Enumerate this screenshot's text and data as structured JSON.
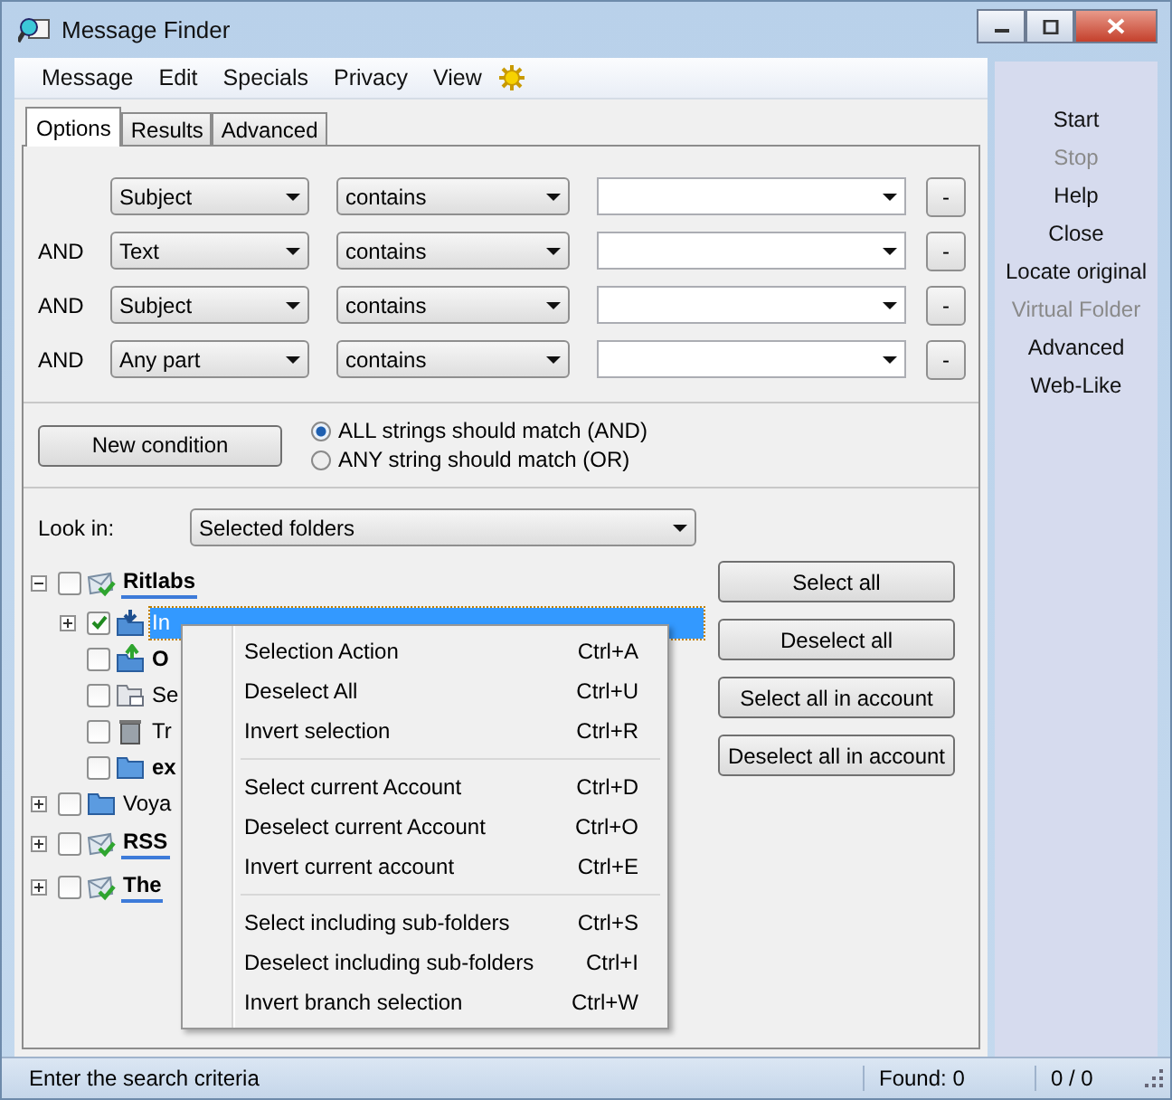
{
  "window": {
    "title": "Message Finder"
  },
  "menu": [
    "Message",
    "Edit",
    "Specials",
    "Privacy",
    "View"
  ],
  "tabs": [
    {
      "label": "Options",
      "selected": true
    },
    {
      "label": "Results",
      "selected": false
    },
    {
      "label": "Advanced",
      "selected": false
    }
  ],
  "conditions": [
    {
      "field": "Subject",
      "operator": "contains",
      "remove_button": "-"
    },
    {
      "connector": "AND",
      "field": "Text",
      "operator": "contains",
      "remove_button": "-"
    },
    {
      "connector": "AND",
      "field": "Subject",
      "operator": "contains",
      "remove_button": "-"
    },
    {
      "connector": "AND",
      "field": "Any part",
      "operator": "contains",
      "remove_button": "-"
    }
  ],
  "new_condition_button": "New condition",
  "match_options": [
    {
      "label": "ALL strings should match (AND)",
      "selected": true
    },
    {
      "label": "ANY string should match (OR)",
      "selected": false
    }
  ],
  "look_in": {
    "label": "Look in:",
    "value": "Selected folders"
  },
  "folder_tree": [
    {
      "label": "Ritlabs",
      "kind": "account",
      "bold": true,
      "checked": false,
      "selected": false,
      "expanded": true,
      "children": [
        {
          "label": "In",
          "kind": "inbox",
          "bold": false,
          "checked": true,
          "selected": true,
          "expanded": false
        },
        {
          "label": "O",
          "kind": "outbox",
          "bold": true,
          "checked": false,
          "selected": false
        },
        {
          "label": "Se",
          "kind": "sent",
          "bold": false,
          "checked": false,
          "selected": false
        },
        {
          "label": "Tr",
          "kind": "trash",
          "bold": false,
          "checked": false,
          "selected": false
        },
        {
          "label": "ex",
          "kind": "folder",
          "bold": true,
          "checked": false,
          "selected": false
        }
      ]
    },
    {
      "label": "Voya",
      "kind": "folder",
      "bold": false,
      "checked": false,
      "selected": false,
      "expanded": false
    },
    {
      "label": "RSS",
      "kind": "account",
      "bold": true,
      "checked": false,
      "selected": false,
      "expanded": false
    },
    {
      "label": "The",
      "kind": "account",
      "bold": true,
      "checked": false,
      "selected": false,
      "expanded": false
    }
  ],
  "selection_buttons": [
    "Select all",
    "Deselect all",
    "Select all in account",
    "Deselect all in account"
  ],
  "context_menu": {
    "groups": [
      [
        {
          "label": "Selection Action",
          "shortcut": "Ctrl+A"
        },
        {
          "label": "Deselect All",
          "shortcut": "Ctrl+U"
        },
        {
          "label": "Invert selection",
          "shortcut": "Ctrl+R"
        }
      ],
      [
        {
          "label": "Select current Account",
          "shortcut": "Ctrl+D"
        },
        {
          "label": "Deselect current Account",
          "shortcut": "Ctrl+O"
        },
        {
          "label": "Invert current account",
          "shortcut": "Ctrl+E"
        }
      ],
      [
        {
          "label": "Select including sub-folders",
          "shortcut": "Ctrl+S"
        },
        {
          "label": "Deselect including sub-folders",
          "shortcut": "Ctrl+I"
        },
        {
          "label": "Invert branch selection",
          "shortcut": "Ctrl+W"
        }
      ]
    ]
  },
  "side_actions": [
    {
      "label": "Start",
      "disabled": false
    },
    {
      "label": "Stop",
      "disabled": true
    },
    {
      "label": "Help",
      "disabled": false
    },
    {
      "label": "Close",
      "disabled": false
    },
    {
      "label": "Locate original",
      "disabled": false
    },
    {
      "label": "Virtual Folder",
      "disabled": true
    },
    {
      "label": "Advanced",
      "disabled": false
    },
    {
      "label": "Web-Like",
      "disabled": false
    }
  ],
  "status_bar": {
    "message": "Enter the search criteria",
    "found": "Found: 0",
    "counter": "0 / 0"
  }
}
